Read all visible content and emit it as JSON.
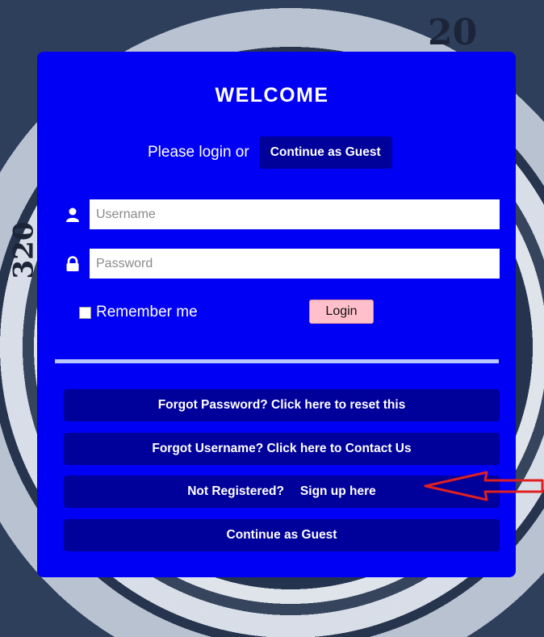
{
  "welcome_title": "WELCOME",
  "login_prompt": "Please login or",
  "guest_top_label": "Continue as Guest",
  "username": {
    "placeholder": "Username",
    "value": ""
  },
  "password": {
    "placeholder": "Password",
    "value": ""
  },
  "remember_label": "Remember me",
  "login_label": "Login",
  "actions": {
    "forgot_password": "Forgot Password? Click here to reset this",
    "forgot_username": "Forgot Username? Click here to Contact Us",
    "not_registered": "Not Registered?",
    "sign_up": "Sign up here",
    "guest_bottom": "Continue as Guest"
  },
  "background_numerals": [
    "20",
    "320"
  ],
  "colors": {
    "card": "#0000f5",
    "button_dark": "#00009a",
    "login_button": "#ffc0cb",
    "divider": "#b8c8ff",
    "annotation_arrow": "#e02020"
  },
  "icons": [
    "user-icon",
    "lock-icon",
    "red-arrow-annotation"
  ]
}
